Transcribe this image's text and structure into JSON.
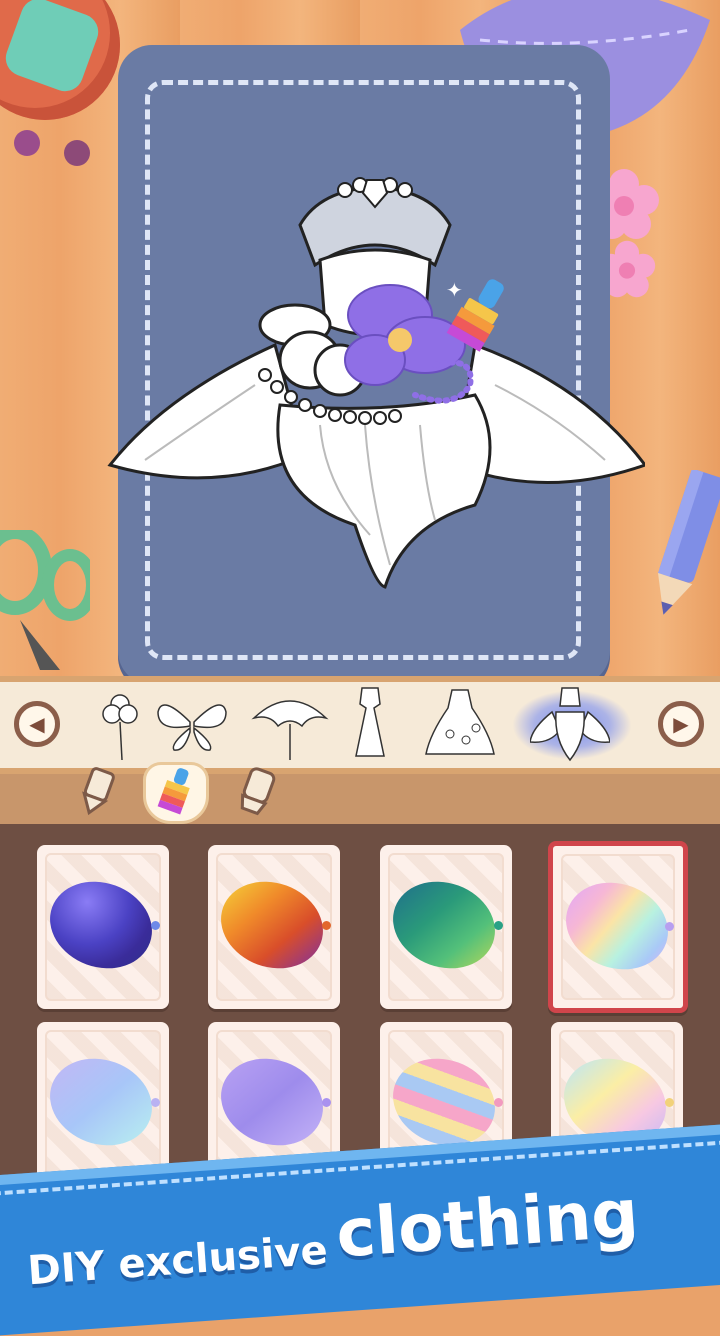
{
  "colors": {
    "wood": "#f0ad74",
    "board": "#6a7ba4",
    "strip": "#f6ead8",
    "panel": "#6e4f43",
    "selected_border": "#d0454b",
    "banner": "#2f86d8"
  },
  "thumbnails": [
    {
      "icon": "flower-outline-icon"
    },
    {
      "icon": "butterfly-outline-icon"
    },
    {
      "icon": "umbrella-outline-icon"
    },
    {
      "icon": "long-dress-outline-icon"
    },
    {
      "icon": "ruffle-dress-outline-icon"
    },
    {
      "icon": "flower-dress-outline-icon",
      "selected": true
    }
  ],
  "tools": [
    "pencil-icon",
    "paint-brush-icon",
    "eraser-icon"
  ],
  "active_tool": "paint-brush-icon",
  "swatches": [
    {
      "name": "blue-purple-glitter",
      "selected": false
    },
    {
      "name": "gold-scales",
      "selected": false
    },
    {
      "name": "green-sequins",
      "selected": false
    },
    {
      "name": "rainbow-pastel",
      "selected": true
    },
    {
      "name": "lavender-stars",
      "selected": false
    },
    {
      "name": "purple-gradient",
      "selected": false
    },
    {
      "name": "pastel-scales",
      "selected": false
    },
    {
      "name": "rainbow-clouds",
      "selected": false
    }
  ],
  "banner": {
    "small": "DIY exclusive",
    "big": "clothing"
  }
}
